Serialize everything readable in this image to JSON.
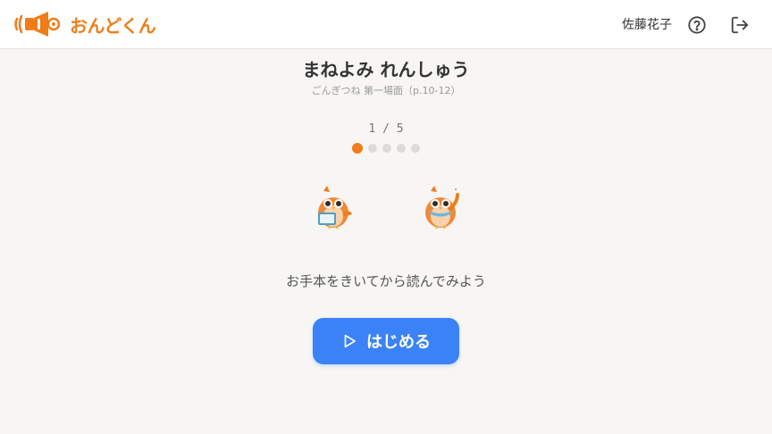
{
  "header": {
    "logo_text": "おんどくん",
    "user_name": "佐藤花子",
    "icons": {
      "help": "help-circle-icon",
      "logout": "logout-icon",
      "logo": "speaker-logo-icon"
    }
  },
  "lesson": {
    "title": "まねよみ れんしゅう",
    "subtitle": "ごんぎつね 第一場面（p.10-12）",
    "progress_text": "1 / 5",
    "current_step": 1,
    "total_steps": 5,
    "instruction": "お手本をきいてから読んでみよう",
    "start_button_label": "はじめる"
  },
  "colors": {
    "brand": "#ef7d1a",
    "accent": "#3b82f6",
    "inactive_dot": "#dddbd8"
  }
}
